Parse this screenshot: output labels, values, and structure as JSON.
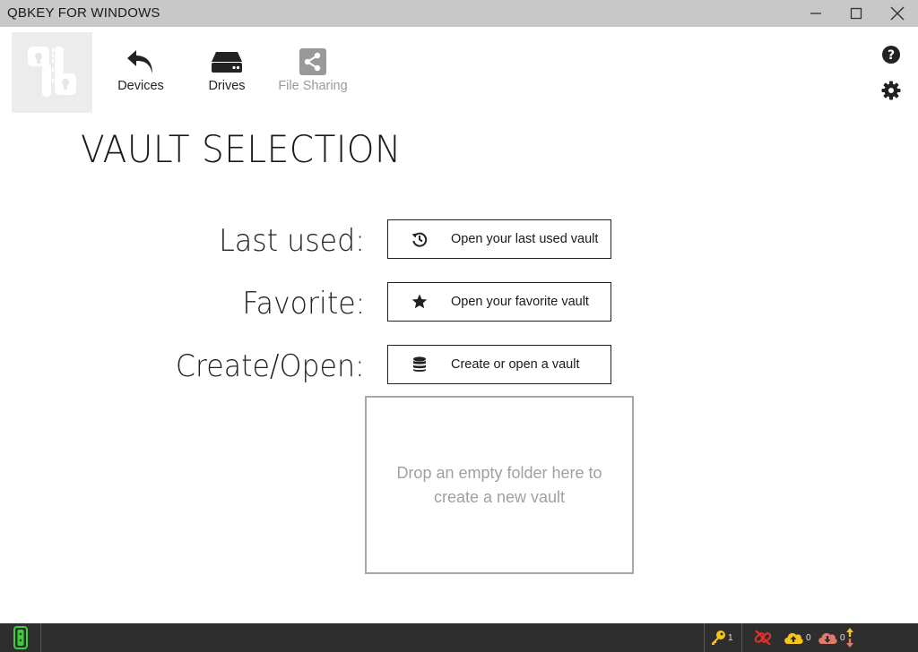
{
  "window": {
    "title": "QBKEY FOR WINDOWS"
  },
  "toolbar": {
    "items": [
      {
        "label": "Devices",
        "icon": "undo-arrow-icon"
      },
      {
        "label": "Drives",
        "icon": "drive-icon"
      },
      {
        "label": "File Sharing",
        "icon": "share-icon",
        "disabled": true
      }
    ],
    "help_icon": "question-circle-icon",
    "settings_icon": "gear-icon"
  },
  "main": {
    "title": "VAULT SELECTION",
    "rows": [
      {
        "label": "Last used:",
        "button": "Open your last used vault",
        "icon": "history-icon"
      },
      {
        "label": "Favorite:",
        "button": "Open your favorite vault",
        "icon": "star-icon"
      },
      {
        "label": "Create/Open:",
        "button": "Create or open a vault",
        "icon": "database-icon"
      }
    ],
    "dropzone_text": "Drop an empty folder here to create a new vault"
  },
  "statusbar": {
    "keys_count": "1",
    "upload_count": "0",
    "download_count": "0"
  },
  "colors": {
    "titlebar": "#c8c8c8",
    "statusbar": "#2e2e2e",
    "accent_green": "#3ecf3e",
    "key_yellow": "#f5c518",
    "link_red": "#e03030",
    "cloud_orange": "#f0a030",
    "cloud_red": "#e07a6a"
  }
}
